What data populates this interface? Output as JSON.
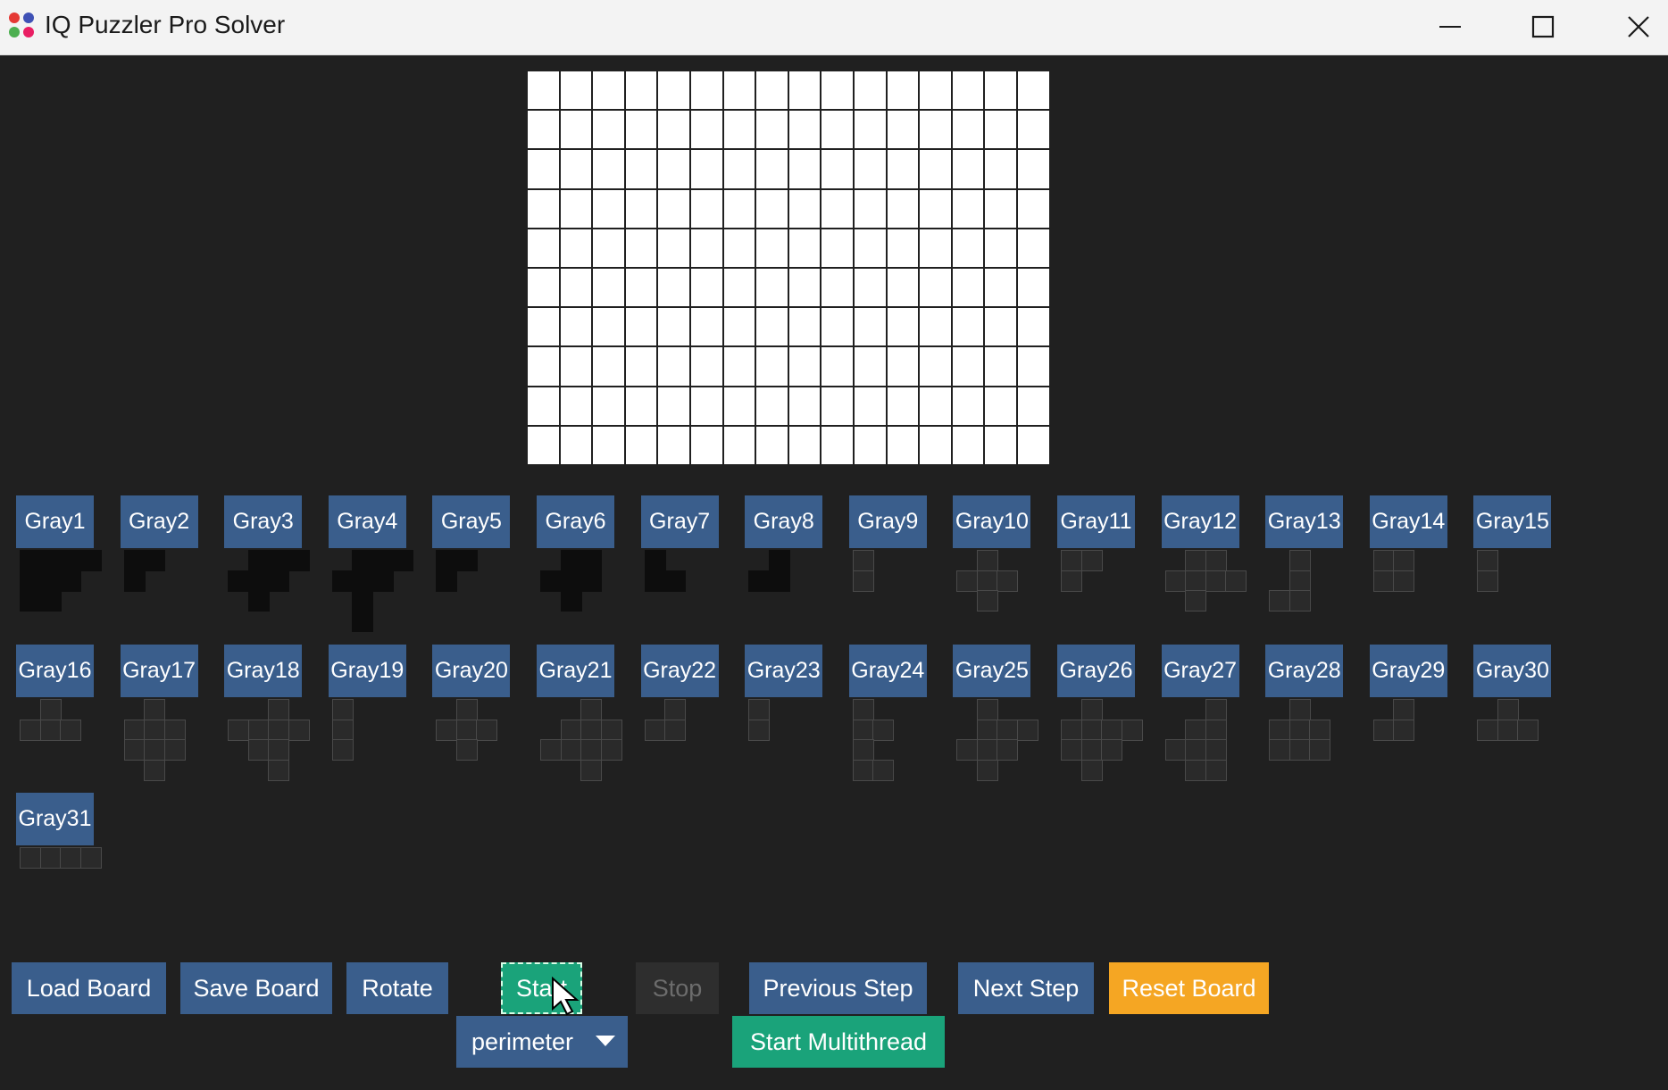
{
  "window": {
    "title": "IQ Puzzler Pro Solver"
  },
  "pieces": [
    {
      "label": "Gray1",
      "shade": "dark",
      "cells": [
        [
          0,
          0
        ],
        [
          1,
          0
        ],
        [
          2,
          0
        ],
        [
          3,
          0
        ],
        [
          0,
          1
        ],
        [
          1,
          1
        ],
        [
          2,
          1
        ],
        [
          0,
          2
        ],
        [
          1,
          2
        ]
      ]
    },
    {
      "label": "Gray2",
      "shade": "dark",
      "cells": [
        [
          0,
          0
        ],
        [
          1,
          0
        ],
        [
          0,
          1
        ]
      ]
    },
    {
      "label": "Gray3",
      "shade": "dark",
      "cells": [
        [
          1,
          0
        ],
        [
          2,
          0
        ],
        [
          3,
          0
        ],
        [
          0,
          1
        ],
        [
          1,
          1
        ],
        [
          2,
          1
        ],
        [
          1,
          2
        ]
      ]
    },
    {
      "label": "Gray4",
      "shade": "dark",
      "cells": [
        [
          1,
          0
        ],
        [
          2,
          0
        ],
        [
          3,
          0
        ],
        [
          0,
          1
        ],
        [
          1,
          1
        ],
        [
          2,
          1
        ],
        [
          1,
          2
        ],
        [
          1,
          3
        ]
      ]
    },
    {
      "label": "Gray5",
      "shade": "dark",
      "cells": [
        [
          0,
          0
        ],
        [
          1,
          0
        ],
        [
          0,
          1
        ]
      ]
    },
    {
      "label": "Gray6",
      "shade": "dark",
      "cells": [
        [
          1,
          0
        ],
        [
          2,
          0
        ],
        [
          0,
          1
        ],
        [
          1,
          1
        ],
        [
          2,
          1
        ],
        [
          1,
          2
        ]
      ]
    },
    {
      "label": "Gray7",
      "shade": "dark",
      "cells": [
        [
          0,
          0
        ],
        [
          0,
          1
        ],
        [
          1,
          1
        ]
      ]
    },
    {
      "label": "Gray8",
      "shade": "dark",
      "cells": [
        [
          1,
          0
        ],
        [
          0,
          1
        ],
        [
          1,
          1
        ]
      ]
    },
    {
      "label": "Gray9",
      "shade": "med",
      "cells": [
        [
          0,
          0
        ],
        [
          0,
          1
        ]
      ]
    },
    {
      "label": "Gray10",
      "shade": "med",
      "cells": [
        [
          1,
          0
        ],
        [
          0,
          1
        ],
        [
          1,
          1
        ],
        [
          2,
          1
        ],
        [
          1,
          2
        ]
      ]
    },
    {
      "label": "Gray11",
      "shade": "med",
      "cells": [
        [
          0,
          0
        ],
        [
          1,
          0
        ],
        [
          0,
          1
        ]
      ]
    },
    {
      "label": "Gray12",
      "shade": "med",
      "cells": [
        [
          1,
          0
        ],
        [
          2,
          0
        ],
        [
          0,
          1
        ],
        [
          1,
          1
        ],
        [
          2,
          1
        ],
        [
          3,
          1
        ],
        [
          1,
          2
        ]
      ]
    },
    {
      "label": "Gray13",
      "shade": "med",
      "cells": [
        [
          1,
          0
        ],
        [
          1,
          1
        ],
        [
          0,
          2
        ],
        [
          1,
          2
        ]
      ]
    },
    {
      "label": "Gray14",
      "shade": "med",
      "cells": [
        [
          0,
          0
        ],
        [
          1,
          0
        ],
        [
          0,
          1
        ],
        [
          1,
          1
        ]
      ]
    },
    {
      "label": "Gray15",
      "shade": "med",
      "cells": [
        [
          0,
          0
        ],
        [
          0,
          1
        ]
      ]
    },
    {
      "label": "Gray16",
      "shade": "med",
      "cells": [
        [
          1,
          0
        ],
        [
          0,
          1
        ],
        [
          1,
          1
        ],
        [
          2,
          1
        ]
      ]
    },
    {
      "label": "Gray17",
      "shade": "med",
      "cells": [
        [
          1,
          0
        ],
        [
          0,
          1
        ],
        [
          1,
          1
        ],
        [
          2,
          1
        ],
        [
          0,
          2
        ],
        [
          1,
          2
        ],
        [
          2,
          2
        ],
        [
          1,
          3
        ]
      ]
    },
    {
      "label": "Gray18",
      "shade": "med",
      "cells": [
        [
          2,
          0
        ],
        [
          0,
          1
        ],
        [
          1,
          1
        ],
        [
          2,
          1
        ],
        [
          3,
          1
        ],
        [
          1,
          2
        ],
        [
          2,
          2
        ],
        [
          2,
          3
        ]
      ]
    },
    {
      "label": "Gray19",
      "shade": "med",
      "cells": [
        [
          0,
          0
        ],
        [
          0,
          1
        ],
        [
          0,
          2
        ]
      ]
    },
    {
      "label": "Gray20",
      "shade": "med",
      "cells": [
        [
          1,
          0
        ],
        [
          0,
          1
        ],
        [
          1,
          1
        ],
        [
          2,
          1
        ],
        [
          1,
          2
        ]
      ]
    },
    {
      "label": "Gray21",
      "shade": "med",
      "cells": [
        [
          2,
          0
        ],
        [
          1,
          1
        ],
        [
          2,
          1
        ],
        [
          3,
          1
        ],
        [
          0,
          2
        ],
        [
          1,
          2
        ],
        [
          2,
          2
        ],
        [
          3,
          2
        ],
        [
          2,
          3
        ]
      ]
    },
    {
      "label": "Gray22",
      "shade": "med",
      "cells": [
        [
          1,
          0
        ],
        [
          0,
          1
        ],
        [
          1,
          1
        ]
      ]
    },
    {
      "label": "Gray23",
      "shade": "med",
      "cells": [
        [
          0,
          0
        ],
        [
          0,
          1
        ]
      ]
    },
    {
      "label": "Gray24",
      "shade": "med",
      "cells": [
        [
          0,
          0
        ],
        [
          0,
          1
        ],
        [
          1,
          1
        ],
        [
          0,
          2
        ],
        [
          0,
          3
        ],
        [
          1,
          3
        ]
      ]
    },
    {
      "label": "Gray25",
      "shade": "med",
      "cells": [
        [
          1,
          0
        ],
        [
          1,
          1
        ],
        [
          2,
          1
        ],
        [
          3,
          1
        ],
        [
          0,
          2
        ],
        [
          1,
          2
        ],
        [
          2,
          2
        ],
        [
          1,
          3
        ]
      ]
    },
    {
      "label": "Gray26",
      "shade": "med",
      "cells": [
        [
          1,
          0
        ],
        [
          0,
          1
        ],
        [
          1,
          1
        ],
        [
          2,
          1
        ],
        [
          3,
          1
        ],
        [
          0,
          2
        ],
        [
          1,
          2
        ],
        [
          2,
          2
        ],
        [
          1,
          3
        ]
      ]
    },
    {
      "label": "Gray27",
      "shade": "med",
      "cells": [
        [
          2,
          0
        ],
        [
          1,
          1
        ],
        [
          2,
          1
        ],
        [
          0,
          2
        ],
        [
          1,
          2
        ],
        [
          2,
          2
        ],
        [
          1,
          3
        ],
        [
          2,
          3
        ]
      ]
    },
    {
      "label": "Gray28",
      "shade": "med",
      "cells": [
        [
          1,
          0
        ],
        [
          0,
          1
        ],
        [
          1,
          1
        ],
        [
          2,
          1
        ],
        [
          0,
          2
        ],
        [
          1,
          2
        ],
        [
          2,
          2
        ]
      ]
    },
    {
      "label": "Gray29",
      "shade": "med",
      "cells": [
        [
          1,
          0
        ],
        [
          0,
          1
        ],
        [
          1,
          1
        ]
      ]
    },
    {
      "label": "Gray30",
      "shade": "med",
      "cells": [
        [
          1,
          0
        ],
        [
          0,
          1
        ],
        [
          1,
          1
        ],
        [
          2,
          1
        ]
      ]
    },
    {
      "label": "Gray31",
      "shade": "med",
      "cells": [
        [
          0,
          0
        ],
        [
          1,
          0
        ],
        [
          2,
          0
        ],
        [
          3,
          0
        ]
      ]
    }
  ],
  "board": {
    "columns": 16,
    "rows": 10
  },
  "controls": {
    "load_board": "Load Board",
    "save_board": "Save Board",
    "rotate": "Rotate",
    "start": "Start",
    "stop": "Stop",
    "previous_step": "Previous Step",
    "next_step": "Next Step",
    "reset_board": "Reset Board",
    "strategy_selected": "perimeter",
    "start_multithread": "Start Multithread"
  },
  "colors": {
    "button_blue": "#3a5e8c",
    "start_green": "#1aa37a",
    "reset_orange": "#f5a623",
    "disabled": "#2e2e2e",
    "background": "#202020"
  }
}
